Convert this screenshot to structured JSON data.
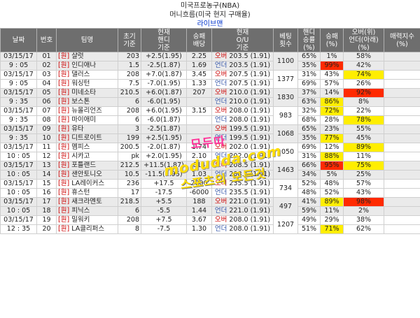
{
  "header": {
    "line1": "미국프로농구(NBA)",
    "line2": "머니흐름(미국 현지 구매율)",
    "line3": "라이브맨"
  },
  "columns": {
    "date": "날짜",
    "num": "번호",
    "team": "팀명",
    "init_base": "초기\n기준",
    "cur_handi": "현재\n핸디\n기준",
    "win_odds": "승패\n배당",
    "cur_ou": "현재\nO/U\n기준",
    "bet_cnt": "베팅\n횟수",
    "handi_pct": "핸디\n승률\n(%)",
    "win_pct": "승패\n(%)",
    "ou_pct": "오버(위)\n언더(아래)\n(%)",
    "attr_pct": "매력지수\n(%)"
  },
  "home_mark": "[원]",
  "over_label": "오버",
  "under_label": "언더",
  "watermarks": {
    "w1": "모두따",
    "w2": "moduddа.com",
    "w3": "스포츠의 모든것"
  },
  "colors": {
    "header_bg": "#6e6e6e",
    "highlight_red": "#ff2a00",
    "highlight_yellow": "#ffee00",
    "row_alt": "#eaeaea"
  },
  "games": [
    {
      "bets": "1100",
      "rows": [
        {
          "date": "03/15/17",
          "num": "01",
          "team": "샬럿",
          "init": "203",
          "handi": "+2.5(1.95)",
          "odds": "2.25",
          "ou_label": "over",
          "ou": "203.5 (1.91)",
          "handi_pct": "65%",
          "win_pct": "1%",
          "win_hl": "",
          "ou_pct": "58%",
          "ou_hl": ""
        },
        {
          "date": "9 : 05",
          "num": "02",
          "team": "인디애나",
          "init": "1.5",
          "handi": "-2.5(1.87)",
          "odds": "1.69",
          "ou_label": "under",
          "ou": "203.5 (1.91)",
          "handi_pct": "35%",
          "win_pct": "99%",
          "win_hl": "red",
          "ou_pct": "42%",
          "ou_hl": ""
        }
      ]
    },
    {
      "bets": "1377",
      "rows": [
        {
          "date": "03/15/17",
          "num": "03",
          "team": "댈러스",
          "init": "208",
          "handi": "+7.0(1.87)",
          "odds": "3.45",
          "ou_label": "over",
          "ou": "207.5 (1.91)",
          "handi_pct": "31%",
          "win_pct": "43%",
          "win_hl": "",
          "ou_pct": "74%",
          "ou_hl": "yellow"
        },
        {
          "date": "9 : 05",
          "num": "04",
          "team": "워싱턴",
          "init": "7.5",
          "handi": "-7.0(1.95)",
          "odds": "1.33",
          "ou_label": "under",
          "ou": "207.5 (1.91)",
          "handi_pct": "69%",
          "win_pct": "57%",
          "win_hl": "",
          "ou_pct": "26%",
          "ou_hl": ""
        }
      ]
    },
    {
      "bets": "1830",
      "rows": [
        {
          "date": "03/15/17",
          "num": "05",
          "team": "미네소타",
          "init": "210.5",
          "handi": "+6.0(1.87)",
          "odds": "207",
          "ou_label": "over",
          "ou": "210.0 (1.91)",
          "handi_pct": "37%",
          "win_pct": "14%",
          "win_hl": "",
          "ou_pct": "92%",
          "ou_hl": "red"
        },
        {
          "date": "9 : 35",
          "num": "06",
          "team": "보스톤",
          "init": "6",
          "handi": "-6.0(1.95)",
          "odds": "",
          "ou_label": "under",
          "ou": "210.0 (1.91)",
          "handi_pct": "63%",
          "win_pct": "86%",
          "win_hl": "yellow",
          "ou_pct": "8%",
          "ou_hl": ""
        }
      ]
    },
    {
      "bets": "983",
      "rows": [
        {
          "date": "03/15/17",
          "num": "07",
          "team": "뉴올리언즈",
          "init": "208",
          "handi": "+6.0(1.95)",
          "odds": "3.15",
          "ou_label": "over",
          "ou": "208.0 (1.91)",
          "handi_pct": "32%",
          "win_pct": "72%",
          "win_hl": "yellow",
          "ou_pct": "22%",
          "ou_hl": ""
        },
        {
          "date": "9 : 35",
          "num": "08",
          "team": "마이애미",
          "init": "6",
          "handi": "-6.0(1.87)",
          "odds": "",
          "ou_label": "under",
          "ou": "208.0 (1.91)",
          "handi_pct": "68%",
          "win_pct": "28%",
          "win_hl": "",
          "ou_pct": "78%",
          "ou_hl": "yellow"
        }
      ]
    },
    {
      "bets": "1068",
      "rows": [
        {
          "date": "03/15/17",
          "num": "09",
          "team": "유타",
          "init": "3",
          "handi": "-2.5(1.87)",
          "odds": "",
          "ou_label": "over",
          "ou": "199.5 (1.91)",
          "handi_pct": "65%",
          "win_pct": "23%",
          "win_hl": "",
          "ou_pct": "55%",
          "ou_hl": ""
        },
        {
          "date": "9 : 35",
          "num": "10",
          "team": "디트로이트",
          "init": "199",
          "handi": "+2.5(1.95)",
          "odds": "",
          "ou_label": "under",
          "ou": "199.5 (1.91)",
          "handi_pct": "35%",
          "win_pct": "77%",
          "win_hl": "yellow",
          "ou_pct": "45%",
          "ou_hl": ""
        }
      ]
    },
    {
      "bets": "1050",
      "rows": [
        {
          "date": "03/15/17",
          "num": "11",
          "team": "멤피스",
          "init": "200.5",
          "handi": "-2.0(1.87)",
          "odds": "1.74",
          "ou_label": "over",
          "ou": "202.0 (1.91)",
          "handi_pct": "69%",
          "win_pct": "12%",
          "win_hl": "",
          "ou_pct": "89%",
          "ou_hl": "yellow"
        },
        {
          "date": "10 : 05",
          "num": "12",
          "team": "시카고",
          "init": "pk",
          "handi": "+2.0(1.95)",
          "odds": "2.10",
          "ou_label": "under",
          "ou": "202.0 (1.91)",
          "handi_pct": "31%",
          "win_pct": "88%",
          "win_hl": "yellow",
          "ou_pct": "11%",
          "ou_hl": ""
        }
      ]
    },
    {
      "bets": "1463",
      "rows": [
        {
          "date": "03/15/17",
          "num": "13",
          "team": "포틀랜드",
          "init": "212.5",
          "handi": "+11.5(1.87)",
          "odds": "614",
          "ou_label": "over",
          "ou": "208.5 (1.91)",
          "handi_pct": "66%",
          "win_pct": "95%",
          "win_hl": "red",
          "ou_pct": "75%",
          "ou_hl": "yellow"
        },
        {
          "date": "10 : 05",
          "num": "14",
          "team": "샌안토니오",
          "init": "10.5",
          "handi": "-11.5(1.95)",
          "odds": "1.03",
          "ou_label": "under",
          "ou": "208.5 (1.91)",
          "handi_pct": "34%",
          "win_pct": "5%",
          "win_hl": "",
          "ou_pct": "25%",
          "ou_hl": ""
        }
      ]
    },
    {
      "bets": "734",
      "rows": [
        {
          "date": "03/15/17",
          "num": "15",
          "team": "LA레이커스",
          "init": "236",
          "handi": "+17.5",
          "odds": "2000",
          "ou_label": "over",
          "ou": "235.5 (1.91)",
          "handi_pct": "52%",
          "win_pct": "48%",
          "win_hl": "",
          "ou_pct": "57%",
          "ou_hl": ""
        },
        {
          "date": "10 : 05",
          "num": "16",
          "team": "휴스턴",
          "init": "17",
          "handi": "-17.5",
          "odds": "-6000",
          "ou_label": "under",
          "ou": "235.5 (1.91)",
          "handi_pct": "48%",
          "win_pct": "52%",
          "win_hl": "",
          "ou_pct": "43%",
          "ou_hl": ""
        }
      ]
    },
    {
      "bets": "497",
      "rows": [
        {
          "date": "03/15/17",
          "num": "17",
          "team": "새크라멘토",
          "init": "218.5",
          "handi": "+5.5",
          "odds": "188",
          "ou_label": "over",
          "ou": "221.0 (1.91)",
          "handi_pct": "41%",
          "win_pct": "89%",
          "win_hl": "yellow",
          "ou_pct": "98%",
          "ou_hl": "red"
        },
        {
          "date": "10 : 05",
          "num": "18",
          "team": "피닉스",
          "init": "6",
          "handi": "-5.5",
          "odds": "1.44",
          "ou_label": "under",
          "ou": "221.0 (1.91)",
          "handi_pct": "59%",
          "win_pct": "11%",
          "win_hl": "",
          "ou_pct": "2%",
          "ou_hl": ""
        }
      ]
    },
    {
      "bets": "1207",
      "rows": [
        {
          "date": "03/15/17",
          "num": "19",
          "team": "밀워키",
          "init": "208",
          "handi": "+7.5",
          "odds": "3.67",
          "ou_label": "over",
          "ou": "208.0 (1.91)",
          "handi_pct": "49%",
          "win_pct": "29%",
          "win_hl": "",
          "ou_pct": "38%",
          "ou_hl": ""
        },
        {
          "date": "12 : 35",
          "num": "20",
          "team": "LA클리퍼스",
          "init": "8",
          "handi": "-7.5",
          "odds": "1.30",
          "ou_label": "under",
          "ou": "208.0 (1.91)",
          "handi_pct": "51%",
          "win_pct": "71%",
          "win_hl": "yellow",
          "ou_pct": "62%",
          "ou_hl": ""
        }
      ]
    }
  ]
}
